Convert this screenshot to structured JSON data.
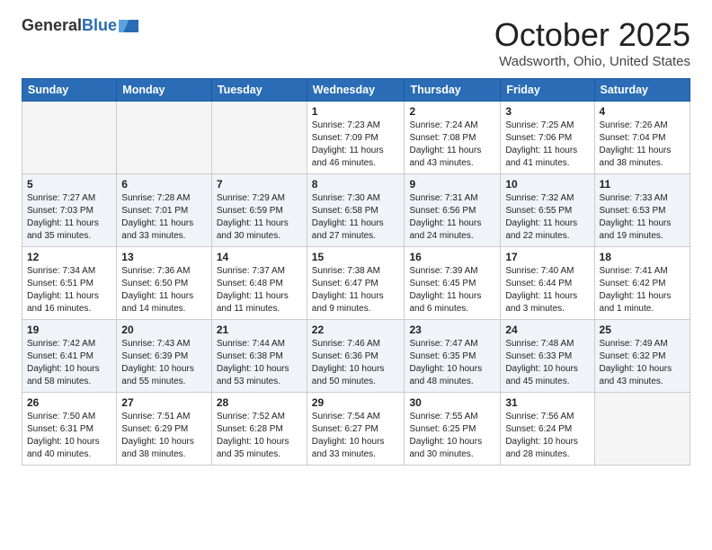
{
  "header": {
    "logo_general": "General",
    "logo_blue": "Blue",
    "month_title": "October 2025",
    "location": "Wadsworth, Ohio, United States"
  },
  "days_of_week": [
    "Sunday",
    "Monday",
    "Tuesday",
    "Wednesday",
    "Thursday",
    "Friday",
    "Saturday"
  ],
  "weeks": [
    [
      {
        "day": "",
        "content": ""
      },
      {
        "day": "",
        "content": ""
      },
      {
        "day": "",
        "content": ""
      },
      {
        "day": "1",
        "content": "Sunrise: 7:23 AM\nSunset: 7:09 PM\nDaylight: 11 hours\nand 46 minutes."
      },
      {
        "day": "2",
        "content": "Sunrise: 7:24 AM\nSunset: 7:08 PM\nDaylight: 11 hours\nand 43 minutes."
      },
      {
        "day": "3",
        "content": "Sunrise: 7:25 AM\nSunset: 7:06 PM\nDaylight: 11 hours\nand 41 minutes."
      },
      {
        "day": "4",
        "content": "Sunrise: 7:26 AM\nSunset: 7:04 PM\nDaylight: 11 hours\nand 38 minutes."
      }
    ],
    [
      {
        "day": "5",
        "content": "Sunrise: 7:27 AM\nSunset: 7:03 PM\nDaylight: 11 hours\nand 35 minutes."
      },
      {
        "day": "6",
        "content": "Sunrise: 7:28 AM\nSunset: 7:01 PM\nDaylight: 11 hours\nand 33 minutes."
      },
      {
        "day": "7",
        "content": "Sunrise: 7:29 AM\nSunset: 6:59 PM\nDaylight: 11 hours\nand 30 minutes."
      },
      {
        "day": "8",
        "content": "Sunrise: 7:30 AM\nSunset: 6:58 PM\nDaylight: 11 hours\nand 27 minutes."
      },
      {
        "day": "9",
        "content": "Sunrise: 7:31 AM\nSunset: 6:56 PM\nDaylight: 11 hours\nand 24 minutes."
      },
      {
        "day": "10",
        "content": "Sunrise: 7:32 AM\nSunset: 6:55 PM\nDaylight: 11 hours\nand 22 minutes."
      },
      {
        "day": "11",
        "content": "Sunrise: 7:33 AM\nSunset: 6:53 PM\nDaylight: 11 hours\nand 19 minutes."
      }
    ],
    [
      {
        "day": "12",
        "content": "Sunrise: 7:34 AM\nSunset: 6:51 PM\nDaylight: 11 hours\nand 16 minutes."
      },
      {
        "day": "13",
        "content": "Sunrise: 7:36 AM\nSunset: 6:50 PM\nDaylight: 11 hours\nand 14 minutes."
      },
      {
        "day": "14",
        "content": "Sunrise: 7:37 AM\nSunset: 6:48 PM\nDaylight: 11 hours\nand 11 minutes."
      },
      {
        "day": "15",
        "content": "Sunrise: 7:38 AM\nSunset: 6:47 PM\nDaylight: 11 hours\nand 9 minutes."
      },
      {
        "day": "16",
        "content": "Sunrise: 7:39 AM\nSunset: 6:45 PM\nDaylight: 11 hours\nand 6 minutes."
      },
      {
        "day": "17",
        "content": "Sunrise: 7:40 AM\nSunset: 6:44 PM\nDaylight: 11 hours\nand 3 minutes."
      },
      {
        "day": "18",
        "content": "Sunrise: 7:41 AM\nSunset: 6:42 PM\nDaylight: 11 hours\nand 1 minute."
      }
    ],
    [
      {
        "day": "19",
        "content": "Sunrise: 7:42 AM\nSunset: 6:41 PM\nDaylight: 10 hours\nand 58 minutes."
      },
      {
        "day": "20",
        "content": "Sunrise: 7:43 AM\nSunset: 6:39 PM\nDaylight: 10 hours\nand 55 minutes."
      },
      {
        "day": "21",
        "content": "Sunrise: 7:44 AM\nSunset: 6:38 PM\nDaylight: 10 hours\nand 53 minutes."
      },
      {
        "day": "22",
        "content": "Sunrise: 7:46 AM\nSunset: 6:36 PM\nDaylight: 10 hours\nand 50 minutes."
      },
      {
        "day": "23",
        "content": "Sunrise: 7:47 AM\nSunset: 6:35 PM\nDaylight: 10 hours\nand 48 minutes."
      },
      {
        "day": "24",
        "content": "Sunrise: 7:48 AM\nSunset: 6:33 PM\nDaylight: 10 hours\nand 45 minutes."
      },
      {
        "day": "25",
        "content": "Sunrise: 7:49 AM\nSunset: 6:32 PM\nDaylight: 10 hours\nand 43 minutes."
      }
    ],
    [
      {
        "day": "26",
        "content": "Sunrise: 7:50 AM\nSunset: 6:31 PM\nDaylight: 10 hours\nand 40 minutes."
      },
      {
        "day": "27",
        "content": "Sunrise: 7:51 AM\nSunset: 6:29 PM\nDaylight: 10 hours\nand 38 minutes."
      },
      {
        "day": "28",
        "content": "Sunrise: 7:52 AM\nSunset: 6:28 PM\nDaylight: 10 hours\nand 35 minutes."
      },
      {
        "day": "29",
        "content": "Sunrise: 7:54 AM\nSunset: 6:27 PM\nDaylight: 10 hours\nand 33 minutes."
      },
      {
        "day": "30",
        "content": "Sunrise: 7:55 AM\nSunset: 6:25 PM\nDaylight: 10 hours\nand 30 minutes."
      },
      {
        "day": "31",
        "content": "Sunrise: 7:56 AM\nSunset: 6:24 PM\nDaylight: 10 hours\nand 28 minutes."
      },
      {
        "day": "",
        "content": ""
      }
    ]
  ]
}
